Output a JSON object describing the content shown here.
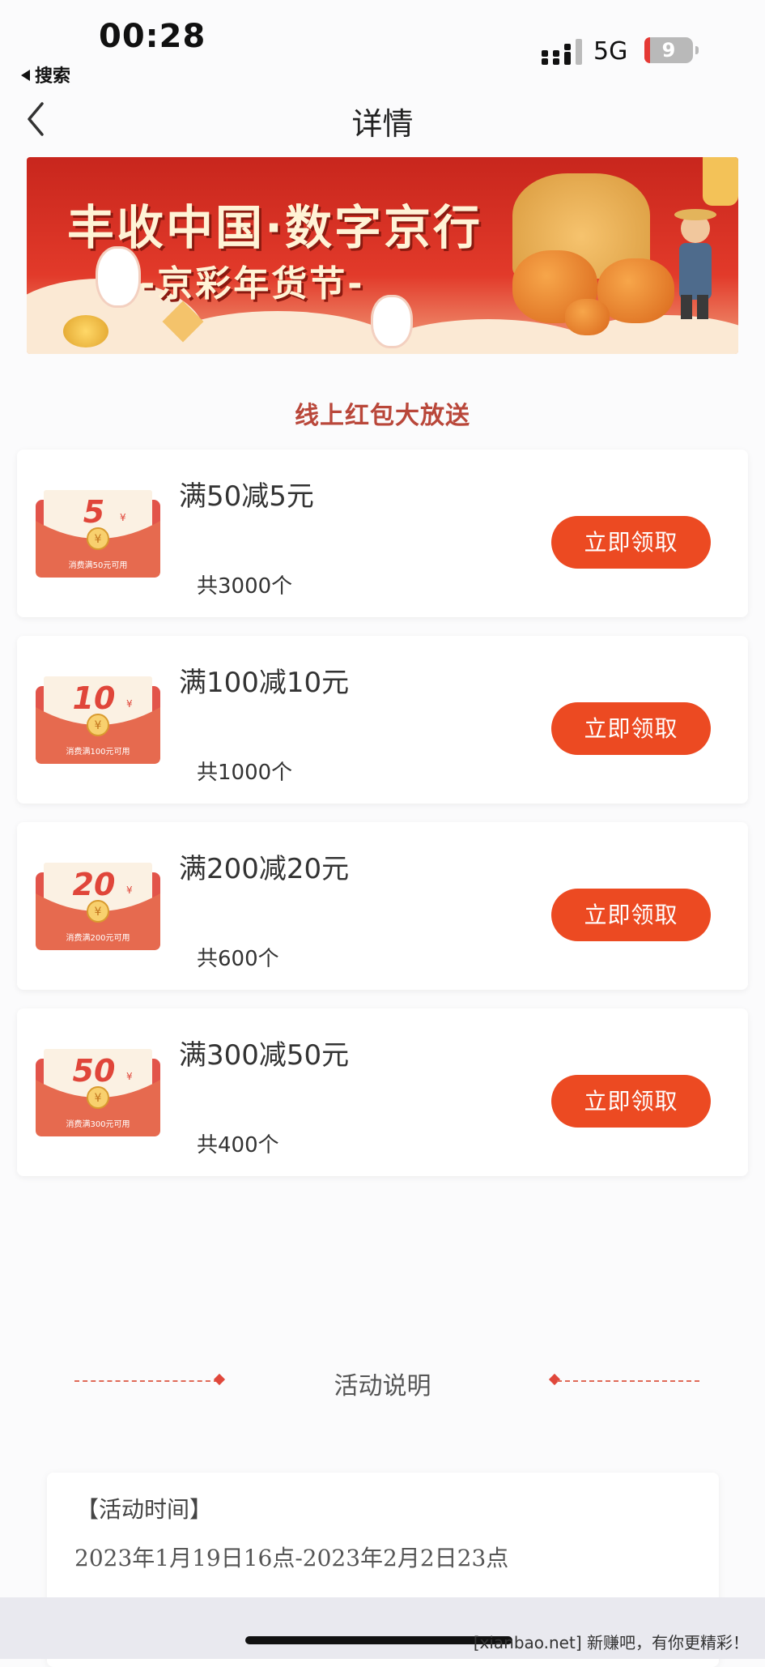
{
  "status_bar": {
    "time": "00:28",
    "back_app": "搜索",
    "network": "5G",
    "battery": "9"
  },
  "nav": {
    "title": "详情",
    "back_icon": "chevron-left-icon"
  },
  "banner": {
    "title_line1": "丰收中国·数字京行",
    "title_line2": "-京彩年货节-"
  },
  "section_title": "线上红包大放送",
  "coupons": [
    {
      "title": "满50减5元",
      "count": "共3000个",
      "button": "立即领取",
      "amount": "5",
      "yen": "¥",
      "condition": "消费满50元可用"
    },
    {
      "title": "满100减10元",
      "count": "共1000个",
      "button": "立即领取",
      "amount": "10",
      "yen": "¥",
      "condition": "消费满100元可用"
    },
    {
      "title": "满200减20元",
      "count": "共600个",
      "button": "立即领取",
      "amount": "20",
      "yen": "¥",
      "condition": "消费满200元可用"
    },
    {
      "title": "满300减50元",
      "count": "共400个",
      "button": "立即领取",
      "amount": "50",
      "yen": "¥",
      "condition": "消费满300元可用"
    }
  ],
  "description": {
    "header": "活动说明",
    "time_label": "【活动时间】",
    "time_value": "2023年1月19日16点-2023年2月2日23点"
  },
  "watermark": "[xianbao.net] 新赚吧，有你更精彩！",
  "colors": {
    "accent": "#ec4a22",
    "section_title": "#b9473a",
    "envelope": "#e2544a"
  }
}
